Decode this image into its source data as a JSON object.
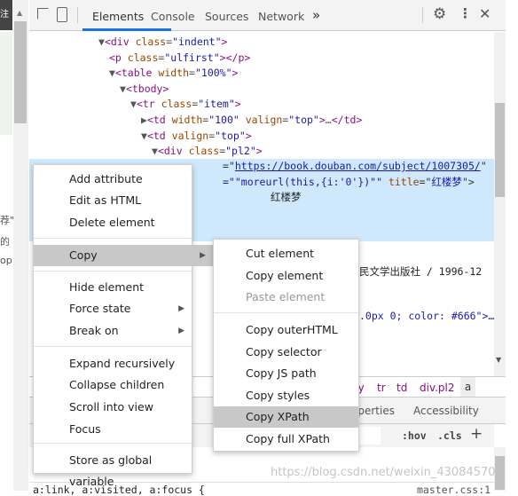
{
  "page_fragment": {
    "top_button": "注册",
    "frag1": "荐\"",
    "frag2": "的",
    "frag3": "op"
  },
  "toolbar": {
    "tabs": [
      "Elements",
      "Console",
      "Sources",
      "Network"
    ],
    "more": "»",
    "active": "Elements"
  },
  "code_lines": [
    {
      "indent": 0,
      "html": "▼<div class=\"indent\">"
    },
    {
      "indent": 1,
      "html": "<p class=\"ulfirst\"></p>"
    },
    {
      "indent": 1,
      "html": "▼<table width=\"100%\">"
    },
    {
      "indent": 2,
      "html": "▼<tbody>"
    },
    {
      "indent": 3,
      "html": "▼<tr class=\"item\">"
    },
    {
      "indent": 4,
      "html": "▶<td width=\"100\" valign=\"top\">…</td>"
    },
    {
      "indent": 4,
      "html": "▼<td valign=\"top\">"
    },
    {
      "indent": 5,
      "html": "▼<div class=\"pl2\">"
    }
  ],
  "selected": {
    "href": "https://book.douban.com/subject/1007305/",
    "onclick": "=\"\"moreurl(this,{i:'0'})\"\"",
    "title_attr": "title",
    "title_val": "红楼梦",
    "text": "红楼梦"
  },
  "behind": {
    "publisher": "民文学出版社 / 1996-12",
    "style_line": ".0px 0; color: #666\">…",
    "breadcrumb": [
      "dy",
      "tr",
      "td",
      "div.pl2",
      "a"
    ],
    "side_tabs": [
      "operties",
      "Accessibility"
    ],
    "hov": ":hov",
    "cls": ".cls",
    "plus": "+",
    "css_rule": "a:link, a:visited, a:focus {",
    "css_source": "master.css:1"
  },
  "context_menu": [
    "Add attribute",
    "Edit as HTML",
    "Delete element",
    "Copy",
    "Hide element",
    "Force state",
    "Break on",
    "Expand recursively",
    "Collapse children",
    "Scroll into view",
    "Focus",
    "Store as global variable"
  ],
  "copy_submenu": [
    "Cut element",
    "Copy element",
    "Paste element",
    "Copy outerHTML",
    "Copy selector",
    "Copy JS path",
    "Copy styles",
    "Copy XPath",
    "Copy full XPath"
  ],
  "watermark": "https://blog.csdn.net/weixin_43084570",
  "colors": {
    "selection": "#cfe8fc",
    "menu_highlight": "#c8c8c8",
    "tab_accent": "#1a73e8"
  }
}
